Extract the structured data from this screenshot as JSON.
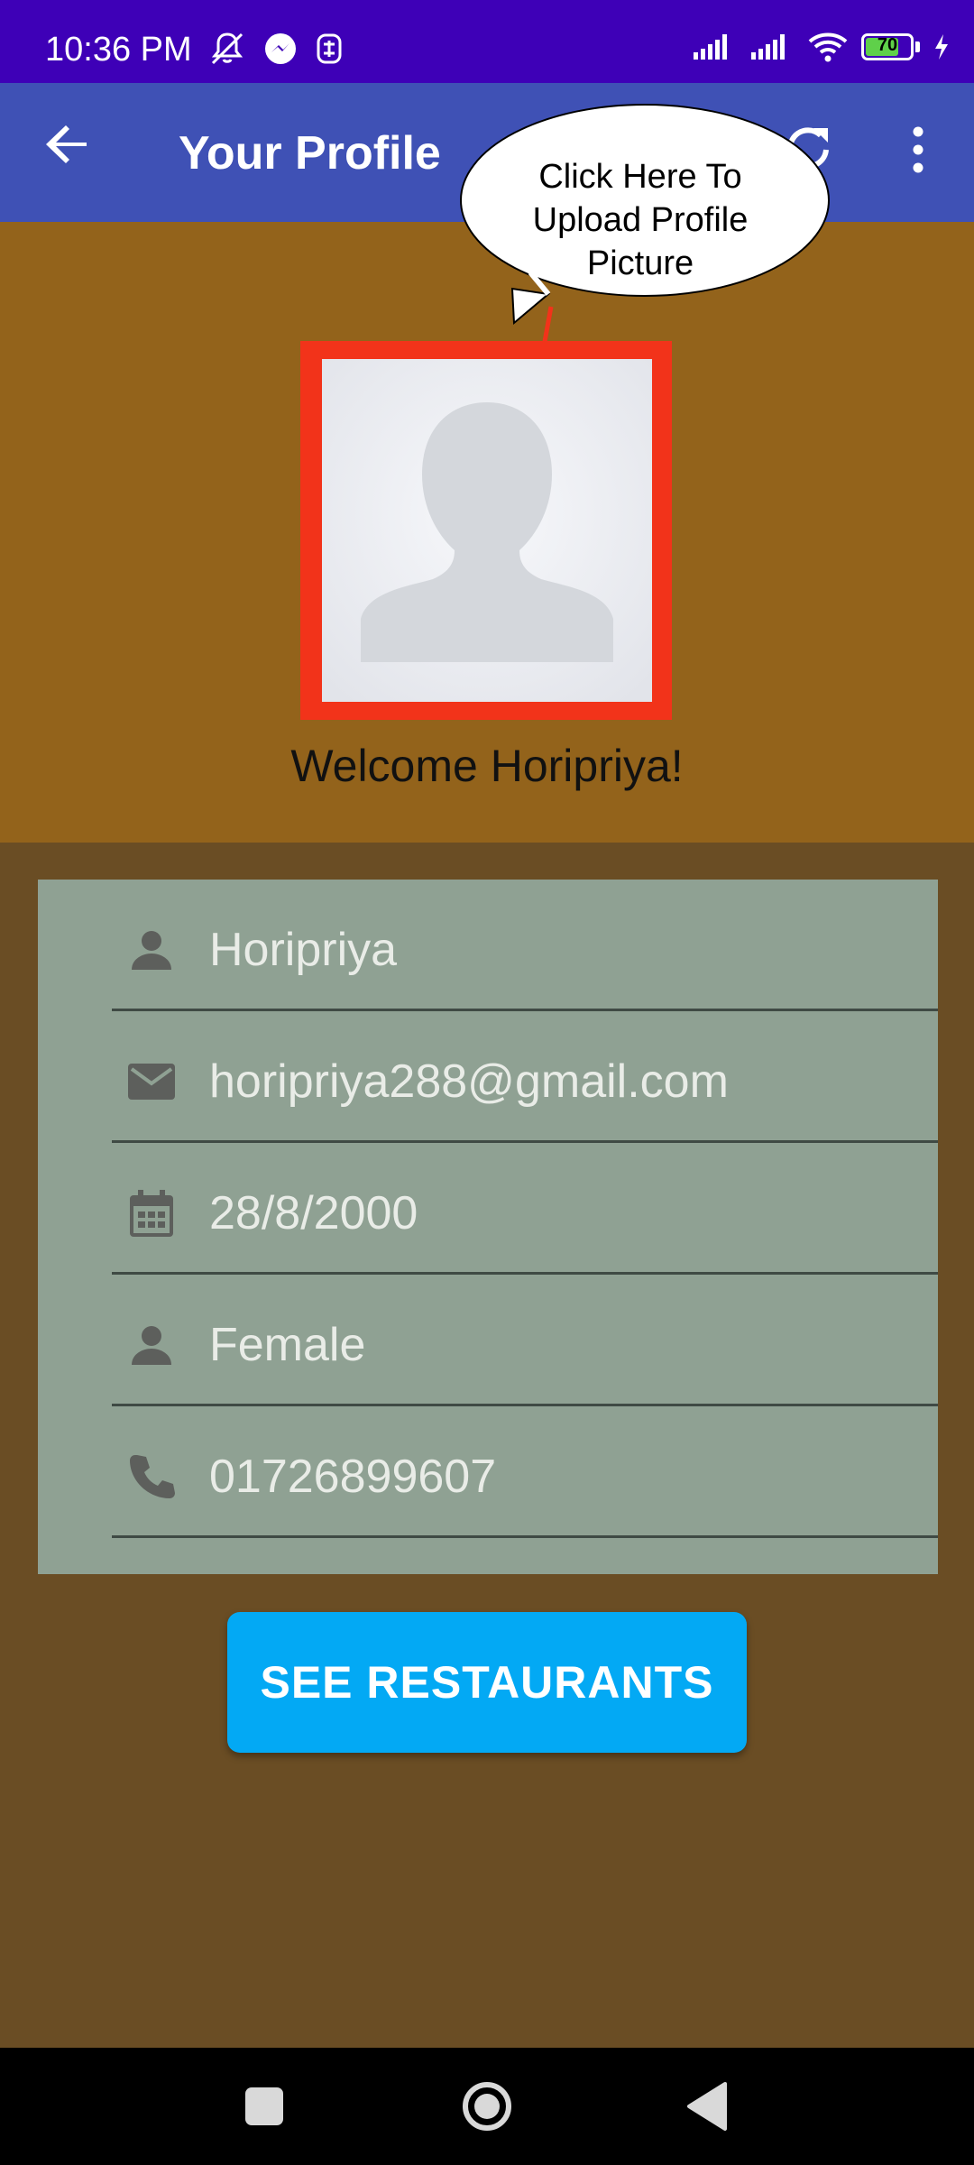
{
  "status_bar": {
    "time": "10:36 PM",
    "battery_level": "70",
    "icons": [
      "mute-icon",
      "messenger-icon",
      "notification-icon",
      "signal-icon",
      "signal-icon",
      "wifi-icon",
      "battery-icon",
      "charging-icon"
    ]
  },
  "app_bar": {
    "title": "Your Profile",
    "back_icon": "arrow-back-icon",
    "refresh_icon": "refresh-icon",
    "more_icon": "more-vert-icon"
  },
  "header": {
    "callout_lines": [
      "Click Here To",
      "Upload Profile",
      "Picture"
    ],
    "welcome": "Welcome Horipriya!"
  },
  "fields": [
    {
      "icon": "person-icon",
      "value": "Horipriya"
    },
    {
      "icon": "email-icon",
      "value": "horipriya288@gmail.com"
    },
    {
      "icon": "calendar-icon",
      "value": "28/8/2000"
    },
    {
      "icon": "person-icon",
      "value": "Female"
    },
    {
      "icon": "phone-icon",
      "value": "01726899607"
    }
  ],
  "button": {
    "label": "SEE RESTAURANTS"
  },
  "colors": {
    "status_bar": "#3e00b7",
    "app_bar": "#3f51b5",
    "header_bg": "#93631b",
    "page_bg": "#6a4d24",
    "card_bg": "#8fa193",
    "button_bg": "#03a9f4",
    "frame_red": "#f2331a"
  }
}
